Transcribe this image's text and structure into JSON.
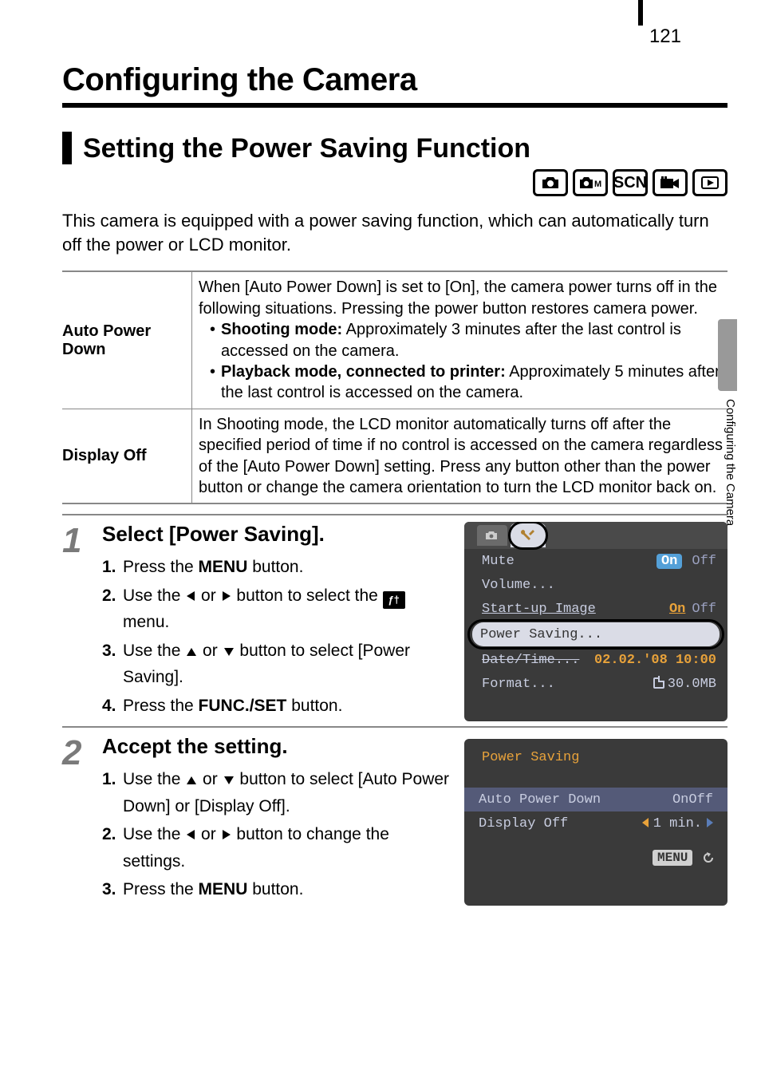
{
  "page_number": "121",
  "h1": "Configuring the Camera",
  "h2": "Setting the Power Saving Function",
  "side_label": "Configuring the Camera",
  "intro": "This camera is equipped with a power saving function, which can automatically turn off the power or LCD monitor.",
  "modes": {
    "scn": "SCN"
  },
  "table": {
    "r1": {
      "label": "Auto Power Down",
      "pre": "When [Auto Power Down] is set to [On], the camera power turns off in the following situations. Pressing the power button restores camera power.",
      "b1_head": "Shooting mode:",
      "b1_tail": " Approximately 3 minutes after the last control is accessed on the camera.",
      "b2_head": "Playback mode, connected to printer:",
      "b2_tail": " Approximately 5 minutes after the last control is accessed on the camera."
    },
    "r2": {
      "label": "Display Off",
      "text": "In Shooting mode, the LCD monitor automatically turns off after the specified period of time if no control is accessed on the camera regardless of the [Auto Power Down] setting. Press any button other than the power button or change the camera orientation to turn the LCD monitor back on."
    }
  },
  "steps": {
    "s1": {
      "num": "1",
      "title": "Select [Power Saving].",
      "l1_n": "1.",
      "l1_a": "Press the ",
      "l1_b": "MENU",
      "l1_c": " button.",
      "l2_n": "2.",
      "l2_a": "Use the ",
      "l2_b": " or ",
      "l2_c": " button to select the ",
      "l2_d": " menu.",
      "l3_n": "3.",
      "l3_a": "Use the ",
      "l3_b": " or ",
      "l3_c": " button to select [Power Saving].",
      "l4_n": "4.",
      "l4_a": "Press the ",
      "l4_b": "FUNC./SET",
      "l4_c": " button."
    },
    "s2": {
      "num": "2",
      "title": "Accept the setting.",
      "l1_n": "1.",
      "l1_a": "Use the ",
      "l1_b": " or ",
      "l1_c": " button to select [Auto Power Down] or [Display Off].",
      "l2_n": "2.",
      "l2_a": "Use the ",
      "l2_b": " or ",
      "l2_c": " button to change the settings.",
      "l3_n": "3.",
      "l3_a": "Press the ",
      "l3_b": "MENU",
      "l3_c": " button."
    }
  },
  "lcd1": {
    "mute_k": "Mute",
    "mute_on": "On",
    "mute_off": "Off",
    "volume_k": "Volume...",
    "startup_k": "Start-up Image",
    "startup_on": "On",
    "startup_off": "Off",
    "ps_k": "Power Saving...",
    "dt_k": "Date/Time...",
    "dt_v": "02.02.'08 10:00",
    "format_k": "Format...",
    "format_v": "30.0MB"
  },
  "lcd2": {
    "title_k": "Power Saving",
    "apd_k": "Auto Power Down",
    "apd_on": "On",
    "apd_off": "Off",
    "do_k": "Display Off",
    "do_v": "1 min.",
    "menu": "MENU"
  }
}
